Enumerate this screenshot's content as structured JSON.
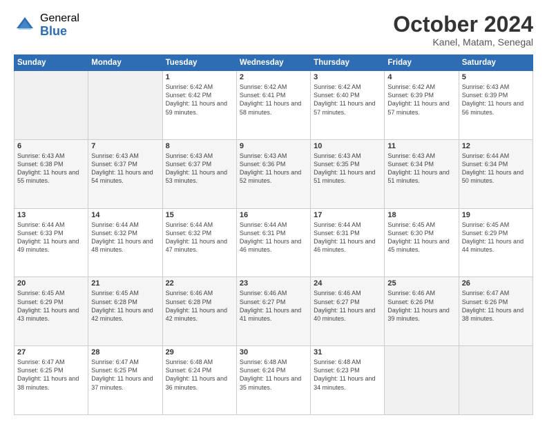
{
  "logo": {
    "general": "General",
    "blue": "Blue"
  },
  "header": {
    "month": "October 2024",
    "location": "Kanel, Matam, Senegal"
  },
  "weekdays": [
    "Sunday",
    "Monday",
    "Tuesday",
    "Wednesday",
    "Thursday",
    "Friday",
    "Saturday"
  ],
  "weeks": [
    [
      {
        "day": "",
        "empty": true
      },
      {
        "day": "",
        "empty": true
      },
      {
        "day": "1",
        "sunrise": "6:42 AM",
        "sunset": "6:42 PM",
        "daylight": "11 hours and 59 minutes."
      },
      {
        "day": "2",
        "sunrise": "6:42 AM",
        "sunset": "6:41 PM",
        "daylight": "11 hours and 58 minutes."
      },
      {
        "day": "3",
        "sunrise": "6:42 AM",
        "sunset": "6:40 PM",
        "daylight": "11 hours and 57 minutes."
      },
      {
        "day": "4",
        "sunrise": "6:42 AM",
        "sunset": "6:39 PM",
        "daylight": "11 hours and 57 minutes."
      },
      {
        "day": "5",
        "sunrise": "6:43 AM",
        "sunset": "6:39 PM",
        "daylight": "11 hours and 56 minutes."
      }
    ],
    [
      {
        "day": "6",
        "sunrise": "6:43 AM",
        "sunset": "6:38 PM",
        "daylight": "11 hours and 55 minutes."
      },
      {
        "day": "7",
        "sunrise": "6:43 AM",
        "sunset": "6:37 PM",
        "daylight": "11 hours and 54 minutes."
      },
      {
        "day": "8",
        "sunrise": "6:43 AM",
        "sunset": "6:37 PM",
        "daylight": "11 hours and 53 minutes."
      },
      {
        "day": "9",
        "sunrise": "6:43 AM",
        "sunset": "6:36 PM",
        "daylight": "11 hours and 52 minutes."
      },
      {
        "day": "10",
        "sunrise": "6:43 AM",
        "sunset": "6:35 PM",
        "daylight": "11 hours and 51 minutes."
      },
      {
        "day": "11",
        "sunrise": "6:43 AM",
        "sunset": "6:34 PM",
        "daylight": "11 hours and 51 minutes."
      },
      {
        "day": "12",
        "sunrise": "6:44 AM",
        "sunset": "6:34 PM",
        "daylight": "11 hours and 50 minutes."
      }
    ],
    [
      {
        "day": "13",
        "sunrise": "6:44 AM",
        "sunset": "6:33 PM",
        "daylight": "11 hours and 49 minutes."
      },
      {
        "day": "14",
        "sunrise": "6:44 AM",
        "sunset": "6:32 PM",
        "daylight": "11 hours and 48 minutes."
      },
      {
        "day": "15",
        "sunrise": "6:44 AM",
        "sunset": "6:32 PM",
        "daylight": "11 hours and 47 minutes."
      },
      {
        "day": "16",
        "sunrise": "6:44 AM",
        "sunset": "6:31 PM",
        "daylight": "11 hours and 46 minutes."
      },
      {
        "day": "17",
        "sunrise": "6:44 AM",
        "sunset": "6:31 PM",
        "daylight": "11 hours and 46 minutes."
      },
      {
        "day": "18",
        "sunrise": "6:45 AM",
        "sunset": "6:30 PM",
        "daylight": "11 hours and 45 minutes."
      },
      {
        "day": "19",
        "sunrise": "6:45 AM",
        "sunset": "6:29 PM",
        "daylight": "11 hours and 44 minutes."
      }
    ],
    [
      {
        "day": "20",
        "sunrise": "6:45 AM",
        "sunset": "6:29 PM",
        "daylight": "11 hours and 43 minutes."
      },
      {
        "day": "21",
        "sunrise": "6:45 AM",
        "sunset": "6:28 PM",
        "daylight": "11 hours and 42 minutes."
      },
      {
        "day": "22",
        "sunrise": "6:46 AM",
        "sunset": "6:28 PM",
        "daylight": "11 hours and 42 minutes."
      },
      {
        "day": "23",
        "sunrise": "6:46 AM",
        "sunset": "6:27 PM",
        "daylight": "11 hours and 41 minutes."
      },
      {
        "day": "24",
        "sunrise": "6:46 AM",
        "sunset": "6:27 PM",
        "daylight": "11 hours and 40 minutes."
      },
      {
        "day": "25",
        "sunrise": "6:46 AM",
        "sunset": "6:26 PM",
        "daylight": "11 hours and 39 minutes."
      },
      {
        "day": "26",
        "sunrise": "6:47 AM",
        "sunset": "6:26 PM",
        "daylight": "11 hours and 38 minutes."
      }
    ],
    [
      {
        "day": "27",
        "sunrise": "6:47 AM",
        "sunset": "6:25 PM",
        "daylight": "11 hours and 38 minutes."
      },
      {
        "day": "28",
        "sunrise": "6:47 AM",
        "sunset": "6:25 PM",
        "daylight": "11 hours and 37 minutes."
      },
      {
        "day": "29",
        "sunrise": "6:48 AM",
        "sunset": "6:24 PM",
        "daylight": "11 hours and 36 minutes."
      },
      {
        "day": "30",
        "sunrise": "6:48 AM",
        "sunset": "6:24 PM",
        "daylight": "11 hours and 35 minutes."
      },
      {
        "day": "31",
        "sunrise": "6:48 AM",
        "sunset": "6:23 PM",
        "daylight": "11 hours and 34 minutes."
      },
      {
        "day": "",
        "empty": true
      },
      {
        "day": "",
        "empty": true
      }
    ]
  ],
  "labels": {
    "sunrise": "Sunrise: ",
    "sunset": "Sunset: ",
    "daylight": "Daylight: "
  }
}
